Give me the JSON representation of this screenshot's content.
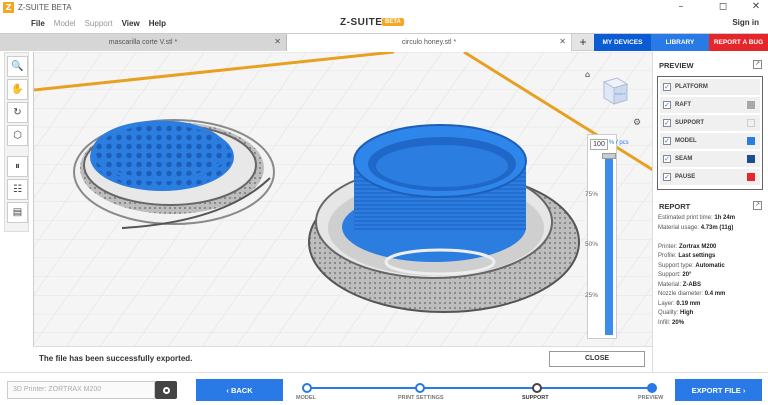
{
  "titlebar": {
    "app_logo": "Z",
    "title": "Z-SUITE BETA",
    "minimize": "–",
    "maximize": "◻",
    "close": "✕"
  },
  "menu": {
    "file": "File",
    "model": "Model",
    "support": "Support",
    "view": "View",
    "help": "Help"
  },
  "brand": {
    "name": "Z-SUITE",
    "badge": "BETA"
  },
  "account": {
    "signin": "Sign in"
  },
  "tabs": [
    {
      "label": "mascarilla corte V.stl *",
      "close": "✕"
    },
    {
      "label": "circulo honey.stl *",
      "close": "✕"
    }
  ],
  "tab_add": "+",
  "top_buttons": {
    "my_devices": "MY DEVICES",
    "library": "LIBRARY",
    "report_bug": "REPORT A BUG"
  },
  "tools": [
    "🔍",
    "✋",
    "↻",
    "⬡",
    "⏸",
    "☷",
    "▤"
  ],
  "layer": {
    "value": "100",
    "unit": "% / pcs",
    "marks": [
      "75%",
      "50%",
      "25%"
    ],
    "fraction": 1.0
  },
  "viewcube": {
    "face_label": "FRONT"
  },
  "status": {
    "message": "The file has been successfully exported.",
    "close_label": "CLOSE"
  },
  "preview": {
    "title": "PREVIEW",
    "items": [
      {
        "label": "PLATFORM",
        "checked": true,
        "color": ""
      },
      {
        "label": "RAFT",
        "checked": true,
        "color": "#a9a9a9"
      },
      {
        "label": "SUPPORT",
        "checked": true,
        "color": "#f0f0f0"
      },
      {
        "label": "MODEL",
        "checked": true,
        "color": "#2b7de0"
      },
      {
        "label": "SEAM",
        "checked": true,
        "color": "#1a4f8f"
      },
      {
        "label": "PAUSE",
        "checked": true,
        "color": "#e5262b"
      }
    ]
  },
  "report": {
    "title": "REPORT",
    "print_time_label": "Estimated print time:",
    "print_time": "1h 24m",
    "material_usage_label": "Material usage:",
    "material_usage": "4.73m (11g)",
    "printer_label": "Printer:",
    "printer": "Zortrax M200",
    "profile_label": "Profile:",
    "profile": "Last settings",
    "support_type_label": "Support type:",
    "support_type": "Automatic",
    "support_label": "Support:",
    "support": "20°",
    "material_label": "Material:",
    "material": "Z-ABS",
    "nozzle_label": "Nozzle diameter:",
    "nozzle": "0.4 mm",
    "layer_label": "Layer:",
    "layer": "0.19 mm",
    "quality_label": "Quality:",
    "quality": "High",
    "infill_label": "Infill:",
    "infill": "20%"
  },
  "bottom": {
    "printer_placeholder": "3D Printer: ZORTRAX M200",
    "back": "‹  BACK",
    "export": "EXPORT FILE  ›",
    "steps": [
      "MODEL",
      "PRINT SETTINGS",
      "SUPPORT",
      "PREVIEW"
    ]
  },
  "colors": {
    "accent": "#2979e6",
    "dark_accent": "#0b5bd3",
    "danger": "#e5262b",
    "model_blue": "#2b7de0",
    "platform_line": "#e8a020"
  }
}
